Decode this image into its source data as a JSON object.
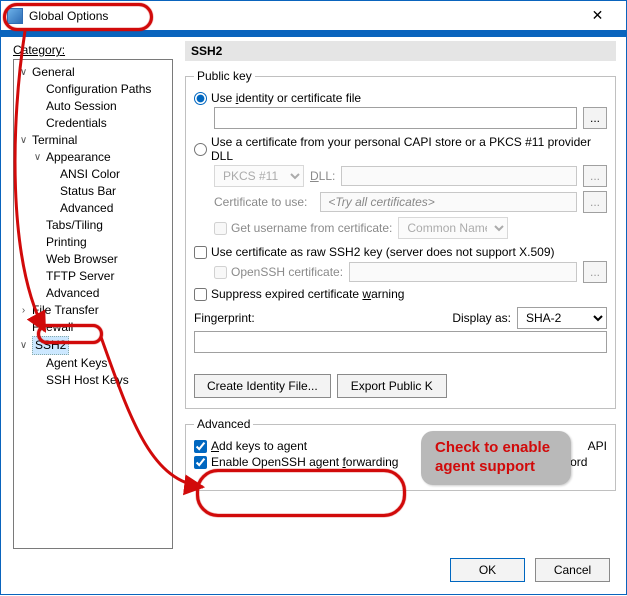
{
  "title": "Global Options",
  "categoryLabel": "Category:",
  "tree": {
    "general": "General",
    "general_children": {
      "configPaths": "Configuration Paths",
      "autoSession": "Auto Session",
      "credentials": "Credentials"
    },
    "terminal": "Terminal",
    "terminal_children": {
      "appearance": "Appearance",
      "appearance_children": {
        "ansiColor": "ANSI Color",
        "statusBar": "Status Bar",
        "advanced": "Advanced"
      },
      "tabs": "Tabs/Tiling",
      "printing": "Printing",
      "webBrowser": "Web Browser",
      "tftp": "TFTP Server",
      "advanced": "Advanced"
    },
    "fileTransfer": "File Transfer",
    "firewall": "Firewall",
    "ssh2": "SSH2",
    "ssh2_children": {
      "agentKeys": "Agent Keys",
      "hostKeys": "SSH Host Keys"
    }
  },
  "panel": {
    "heading": "SSH2",
    "publicKeyLegend": "Public key",
    "useIdentity_pre": "Use ",
    "useIdentity_u": "i",
    "useIdentity_post": "dentity or certificate file",
    "dots": "...",
    "useCapi": "Use a certificate from your personal CAPI store or a PKCS #11 provider DLL",
    "pkcsLabel": "PKCS #11",
    "dllLabel_u": "D",
    "dllLabel_post": "LL:",
    "certToUseLabel": "Certificate to use:",
    "tryAll": " <Try all certificates>",
    "getUser": "Get username from certificate:",
    "commonName": "Common Name",
    "useRaw": "Use certificate as raw SSH2 key (server does not support X.509)",
    "opensshCert": "OpenSSH certificate:",
    "suppress_pre": "Suppress expired certificate ",
    "suppress_u": "w",
    "suppress_post": "arning",
    "fingerprint": "Fingerprint:",
    "displayAs": "Display as:",
    "sha2": "SHA-2",
    "createIdentity": "Create Identity File...",
    "exportPublic": "Export Public K",
    "advancedLegend": "Advanced",
    "addKeys_u": "A",
    "addKeys_post": "dd keys to agent",
    "enableFwd_pre": "Enable OpenSSH agent ",
    "enableFwd_u": "f",
    "enableFwd_post": "orwarding",
    "capiTrail": "API",
    "cachePwd_u": "C",
    "cachePwd_post": "ache session password"
  },
  "footer": {
    "ok": "OK",
    "cancel": "Cancel"
  },
  "annotation": {
    "callout_l1": "Check to enable",
    "callout_l2": "agent support"
  }
}
